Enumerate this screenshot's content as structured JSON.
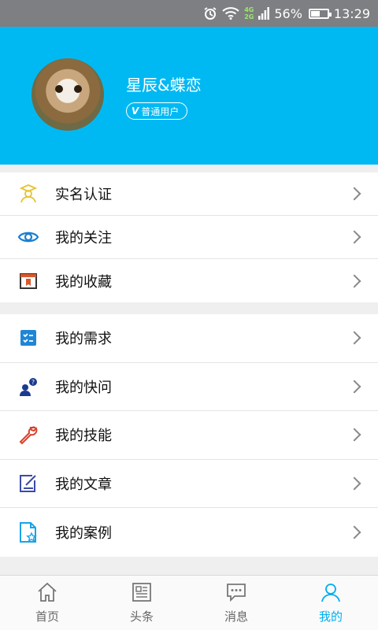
{
  "status_bar": {
    "net_top": "4G",
    "net_bottom": "2G",
    "battery": "56%",
    "battery_level": 0.56,
    "time": "13:29"
  },
  "profile": {
    "username": "星辰&蝶恋",
    "badge_icon": "V",
    "badge_label": "普通用户"
  },
  "menu_group1": [
    {
      "label": "实名认证",
      "icon": "verified-user-icon"
    },
    {
      "label": "我的关注",
      "icon": "eye-icon"
    },
    {
      "label": "我的收藏",
      "icon": "bookmark-icon"
    }
  ],
  "menu_group2": [
    {
      "label": "我的需求",
      "icon": "checklist-icon"
    },
    {
      "label": "我的快问",
      "icon": "quick-question-icon"
    },
    {
      "label": "我的技能",
      "icon": "wrench-icon"
    },
    {
      "label": "我的文章",
      "icon": "edit-document-icon"
    },
    {
      "label": "我的案例",
      "icon": "case-file-icon"
    }
  ],
  "tabs": [
    {
      "label": "首页",
      "icon": "home-icon",
      "active": false
    },
    {
      "label": "头条",
      "icon": "news-icon",
      "active": false
    },
    {
      "label": "消息",
      "icon": "message-icon",
      "active": false
    },
    {
      "label": "我的",
      "icon": "user-icon",
      "active": true
    }
  ],
  "colors": {
    "header": "#00b9f3",
    "active_tab": "#00aef0"
  }
}
